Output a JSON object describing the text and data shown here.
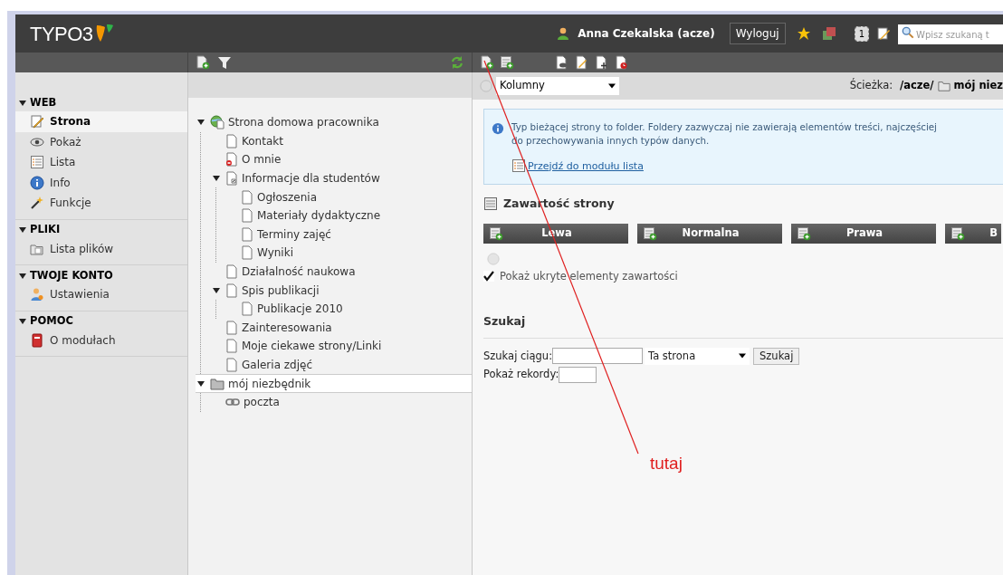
{
  "header": {
    "logo": "TYPO3",
    "user": "Anna Czekalska (acze)",
    "logout": "Wyloguj",
    "badge": "1",
    "search": {
      "placeholder": "Wpisz szukaną t"
    }
  },
  "modules": [
    {
      "title": "WEB",
      "expanded": true,
      "items": [
        {
          "label": "Strona",
          "kind": "edit",
          "selected": true
        },
        {
          "label": "Pokaż",
          "kind": "view",
          "selected": false
        },
        {
          "label": "Lista",
          "kind": "list",
          "selected": false
        },
        {
          "label": "Info",
          "kind": "info",
          "selected": false
        },
        {
          "label": "Funkcje",
          "kind": "functions",
          "selected": false
        }
      ]
    },
    {
      "title": "PLIKI",
      "expanded": true,
      "items": [
        {
          "label": "Lista plików",
          "kind": "files",
          "selected": false
        }
      ]
    },
    {
      "title": "TWOJE KONTO",
      "expanded": true,
      "items": [
        {
          "label": "Ustawienia",
          "kind": "settings",
          "selected": false
        }
      ]
    },
    {
      "title": "POMOC",
      "expanded": true,
      "items": [
        {
          "label": "O modułach",
          "kind": "help",
          "selected": false
        }
      ]
    }
  ],
  "tree": [
    {
      "label": "Strona domowa pracownika",
      "kind": "root",
      "expanded": true,
      "selected": false,
      "children": [
        {
          "label": "Kontakt",
          "kind": "page",
          "selected": false
        },
        {
          "label": "O mnie",
          "kind": "hidden",
          "selected": false
        },
        {
          "label": "Informacje dla studentów",
          "kind": "shortcut",
          "expanded": true,
          "selected": false,
          "children": [
            {
              "label": "Ogłoszenia",
              "kind": "page",
              "selected": false
            },
            {
              "label": "Materiały dydaktyczne",
              "kind": "page",
              "selected": false
            },
            {
              "label": "Terminy zajęć",
              "kind": "page",
              "selected": false
            },
            {
              "label": "Wyniki",
              "kind": "page",
              "selected": false
            }
          ]
        },
        {
          "label": "Działalność naukowa",
          "kind": "page",
          "selected": false
        },
        {
          "label": "Spis publikacji",
          "kind": "page",
          "expanded": true,
          "selected": false,
          "children": [
            {
              "label": "Publikacje 2010",
              "kind": "page",
              "selected": false
            }
          ]
        },
        {
          "label": "Zainteresowania",
          "kind": "page",
          "selected": false
        },
        {
          "label": "Moje ciekawe strony/Linki",
          "kind": "page",
          "selected": false
        },
        {
          "label": "Galeria zdjęć",
          "kind": "page",
          "selected": false
        }
      ]
    },
    {
      "label": "mój niezbędnik",
      "kind": "folder",
      "expanded": true,
      "selected": true,
      "children": [
        {
          "label": "poczta",
          "kind": "link",
          "selected": false
        }
      ]
    }
  ],
  "docheader": {
    "view_select": "Kolumny",
    "path_label": "Ścieżka:",
    "path_prefix": "/acze/",
    "path_folder": "mój niez"
  },
  "info": {
    "lines": [
      "Typ bieżącej strony to folder. Foldery zazwyczaj nie zawierają elementów treści, najczęściej",
      "do przechowywania innych typów danych."
    ],
    "link": "Przejdź do modułu lista"
  },
  "content": {
    "title": "Zawartość strony",
    "columns": [
      "Lewa",
      "Normalna",
      "Prawa",
      "B"
    ],
    "show_hidden": {
      "label": "Pokaż ukryte elementy zawartości",
      "checked": true
    }
  },
  "search": {
    "title": "Szukaj",
    "string_label": "Szukaj ciągu:",
    "scope": "Ta strona",
    "button": "Szukaj",
    "records_label": "Pokaż rekordy:"
  },
  "annotation": {
    "text": "tutaj"
  }
}
